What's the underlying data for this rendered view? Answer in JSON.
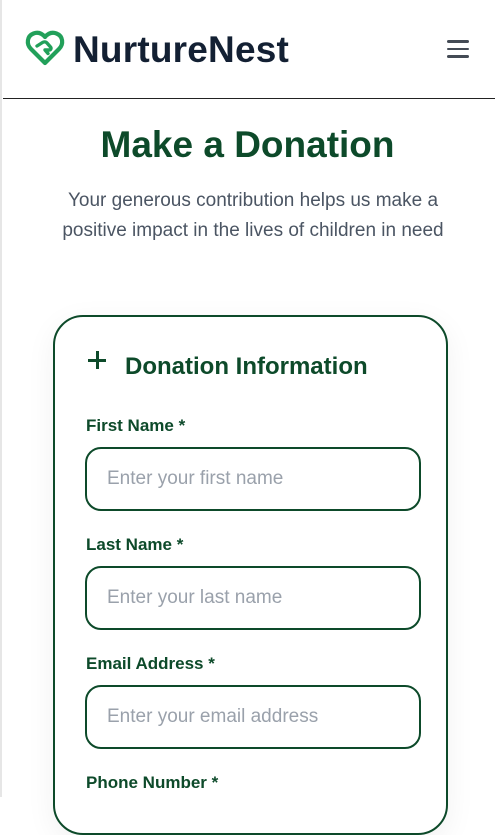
{
  "header": {
    "brand_name": "NurtureNest",
    "logo_icon": "heart-hands-icon",
    "menu_icon": "hamburger-menu-icon"
  },
  "hero": {
    "title": "Make a Donation",
    "subtitle": "Your generous contribution helps us make a positive impact in the lives of children in need"
  },
  "form": {
    "section_icon": "plus-icon",
    "section_title": "Donation Information",
    "fields": {
      "first_name": {
        "label": "First Name *",
        "placeholder": "Enter your first name",
        "value": ""
      },
      "last_name": {
        "label": "Last Name *",
        "placeholder": "Enter your last name",
        "value": ""
      },
      "email": {
        "label": "Email Address *",
        "placeholder": "Enter your email address",
        "value": ""
      },
      "phone": {
        "label": "Phone Number *"
      }
    }
  },
  "colors": {
    "brand_green": "#0d4a2a",
    "logo_green": "#22a05a",
    "text_dark": "#132033",
    "text_muted": "#4b5563",
    "placeholder": "#9aa1ab"
  }
}
